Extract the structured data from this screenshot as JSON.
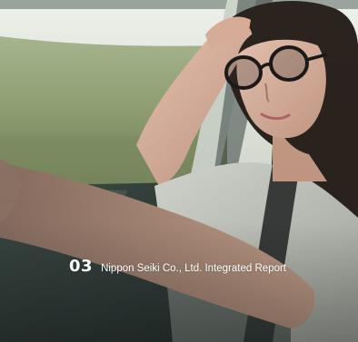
{
  "page": {
    "number": "03",
    "report_title": "Nippon Seiki Co., Ltd. Integrated Report"
  },
  "photo": {
    "description_icon": "photo-driver-woman",
    "colors": {
      "sky": "#dfe4dc",
      "field": "#9fb28a",
      "interior": "#2f3a38",
      "skin": "#d9b4a0",
      "shirt": "#c9ccc4",
      "hair": "#2a211c"
    }
  }
}
